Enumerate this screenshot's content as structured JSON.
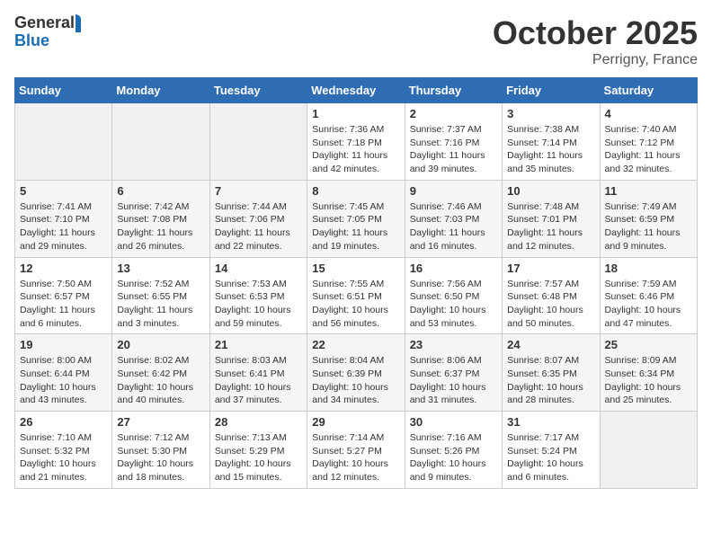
{
  "header": {
    "logo_line1": "General",
    "logo_line2": "Blue",
    "month": "October 2025",
    "location": "Perrigny, France"
  },
  "days_of_week": [
    "Sunday",
    "Monday",
    "Tuesday",
    "Wednesday",
    "Thursday",
    "Friday",
    "Saturday"
  ],
  "weeks": [
    [
      {
        "day": "",
        "info": ""
      },
      {
        "day": "",
        "info": ""
      },
      {
        "day": "",
        "info": ""
      },
      {
        "day": "1",
        "info": "Sunrise: 7:36 AM\nSunset: 7:18 PM\nDaylight: 11 hours\nand 42 minutes."
      },
      {
        "day": "2",
        "info": "Sunrise: 7:37 AM\nSunset: 7:16 PM\nDaylight: 11 hours\nand 39 minutes."
      },
      {
        "day": "3",
        "info": "Sunrise: 7:38 AM\nSunset: 7:14 PM\nDaylight: 11 hours\nand 35 minutes."
      },
      {
        "day": "4",
        "info": "Sunrise: 7:40 AM\nSunset: 7:12 PM\nDaylight: 11 hours\nand 32 minutes."
      }
    ],
    [
      {
        "day": "5",
        "info": "Sunrise: 7:41 AM\nSunset: 7:10 PM\nDaylight: 11 hours\nand 29 minutes."
      },
      {
        "day": "6",
        "info": "Sunrise: 7:42 AM\nSunset: 7:08 PM\nDaylight: 11 hours\nand 26 minutes."
      },
      {
        "day": "7",
        "info": "Sunrise: 7:44 AM\nSunset: 7:06 PM\nDaylight: 11 hours\nand 22 minutes."
      },
      {
        "day": "8",
        "info": "Sunrise: 7:45 AM\nSunset: 7:05 PM\nDaylight: 11 hours\nand 19 minutes."
      },
      {
        "day": "9",
        "info": "Sunrise: 7:46 AM\nSunset: 7:03 PM\nDaylight: 11 hours\nand 16 minutes."
      },
      {
        "day": "10",
        "info": "Sunrise: 7:48 AM\nSunset: 7:01 PM\nDaylight: 11 hours\nand 12 minutes."
      },
      {
        "day": "11",
        "info": "Sunrise: 7:49 AM\nSunset: 6:59 PM\nDaylight: 11 hours\nand 9 minutes."
      }
    ],
    [
      {
        "day": "12",
        "info": "Sunrise: 7:50 AM\nSunset: 6:57 PM\nDaylight: 11 hours\nand 6 minutes."
      },
      {
        "day": "13",
        "info": "Sunrise: 7:52 AM\nSunset: 6:55 PM\nDaylight: 11 hours\nand 3 minutes."
      },
      {
        "day": "14",
        "info": "Sunrise: 7:53 AM\nSunset: 6:53 PM\nDaylight: 10 hours\nand 59 minutes."
      },
      {
        "day": "15",
        "info": "Sunrise: 7:55 AM\nSunset: 6:51 PM\nDaylight: 10 hours\nand 56 minutes."
      },
      {
        "day": "16",
        "info": "Sunrise: 7:56 AM\nSunset: 6:50 PM\nDaylight: 10 hours\nand 53 minutes."
      },
      {
        "day": "17",
        "info": "Sunrise: 7:57 AM\nSunset: 6:48 PM\nDaylight: 10 hours\nand 50 minutes."
      },
      {
        "day": "18",
        "info": "Sunrise: 7:59 AM\nSunset: 6:46 PM\nDaylight: 10 hours\nand 47 minutes."
      }
    ],
    [
      {
        "day": "19",
        "info": "Sunrise: 8:00 AM\nSunset: 6:44 PM\nDaylight: 10 hours\nand 43 minutes."
      },
      {
        "day": "20",
        "info": "Sunrise: 8:02 AM\nSunset: 6:42 PM\nDaylight: 10 hours\nand 40 minutes."
      },
      {
        "day": "21",
        "info": "Sunrise: 8:03 AM\nSunset: 6:41 PM\nDaylight: 10 hours\nand 37 minutes."
      },
      {
        "day": "22",
        "info": "Sunrise: 8:04 AM\nSunset: 6:39 PM\nDaylight: 10 hours\nand 34 minutes."
      },
      {
        "day": "23",
        "info": "Sunrise: 8:06 AM\nSunset: 6:37 PM\nDaylight: 10 hours\nand 31 minutes."
      },
      {
        "day": "24",
        "info": "Sunrise: 8:07 AM\nSunset: 6:35 PM\nDaylight: 10 hours\nand 28 minutes."
      },
      {
        "day": "25",
        "info": "Sunrise: 8:09 AM\nSunset: 6:34 PM\nDaylight: 10 hours\nand 25 minutes."
      }
    ],
    [
      {
        "day": "26",
        "info": "Sunrise: 7:10 AM\nSunset: 5:32 PM\nDaylight: 10 hours\nand 21 minutes."
      },
      {
        "day": "27",
        "info": "Sunrise: 7:12 AM\nSunset: 5:30 PM\nDaylight: 10 hours\nand 18 minutes."
      },
      {
        "day": "28",
        "info": "Sunrise: 7:13 AM\nSunset: 5:29 PM\nDaylight: 10 hours\nand 15 minutes."
      },
      {
        "day": "29",
        "info": "Sunrise: 7:14 AM\nSunset: 5:27 PM\nDaylight: 10 hours\nand 12 minutes."
      },
      {
        "day": "30",
        "info": "Sunrise: 7:16 AM\nSunset: 5:26 PM\nDaylight: 10 hours\nand 9 minutes."
      },
      {
        "day": "31",
        "info": "Sunrise: 7:17 AM\nSunset: 5:24 PM\nDaylight: 10 hours\nand 6 minutes."
      },
      {
        "day": "",
        "info": ""
      }
    ]
  ]
}
